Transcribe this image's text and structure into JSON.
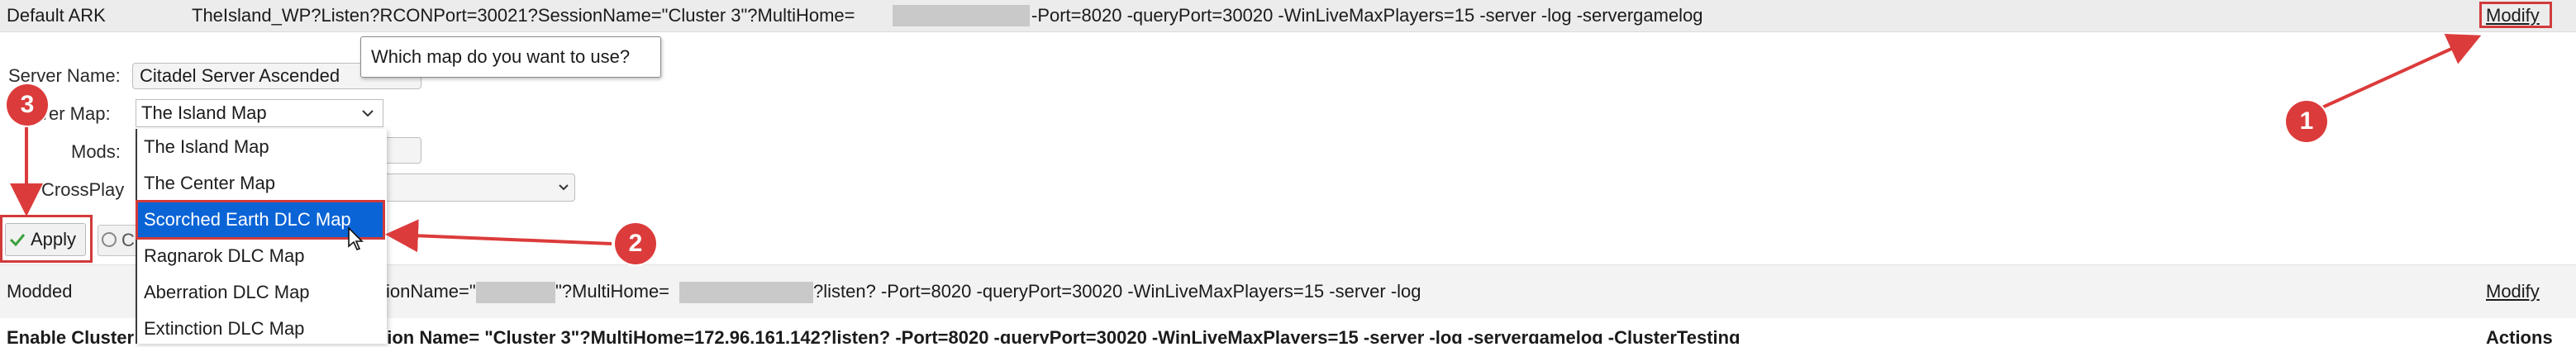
{
  "profiles": {
    "default": {
      "name": "Default ARK",
      "command_part1": "TheIsland_WP?Listen?RCONPort=30021?SessionName=\"Cluster 3\"?MultiHome=",
      "command_part2": "-Port=8020 -queryPort=30020 -WinLiveMaxPlayers=15 -server -log -servergamelog",
      "modify_label": "Modify"
    },
    "modded": {
      "name": "Modded",
      "command_part1": "sionName=\"",
      "command_part2": "\"?MultiHome=",
      "command_part3": "?listen? -Port=8020 -queryPort=30020 -WinLiveMaxPlayers=15 -server -log",
      "modify_label": "Modify"
    },
    "cluster": {
      "name": "Enable Cluster",
      "command_fragment": "sion Name= \"Cluster 3\"?MultiHome=172.96.161.142?listen? -Port=8020 -queryPort=30020 -WinLiveMaxPlayers=15 -server -log -servergamelog -ClusterTesting",
      "action_label": "Actions"
    }
  },
  "form": {
    "server_name_label": "Server Name:",
    "server_name_value": "Citadel Server Ascended",
    "server_map_label": "ver Map:",
    "server_map_value": "The Island Map",
    "mods_label": "Mods:",
    "crossplay_label": "CrossPlay"
  },
  "tooltip": "Which map do you want to use?",
  "map_options": [
    "The Island Map",
    "The Center Map",
    "Scorched Earth DLC Map",
    "Ragnarok DLC Map",
    "Aberration DLC Map",
    "Extinction DLC Map"
  ],
  "buttons": {
    "apply_label": "Apply",
    "cancel_label": "C"
  },
  "annotations": {
    "step1": "1",
    "step2": "2",
    "step3": "3",
    "color": "#dc3b3b"
  },
  "colors": {
    "selection": "#0a64d6",
    "apply_check": "#3aa03a"
  }
}
